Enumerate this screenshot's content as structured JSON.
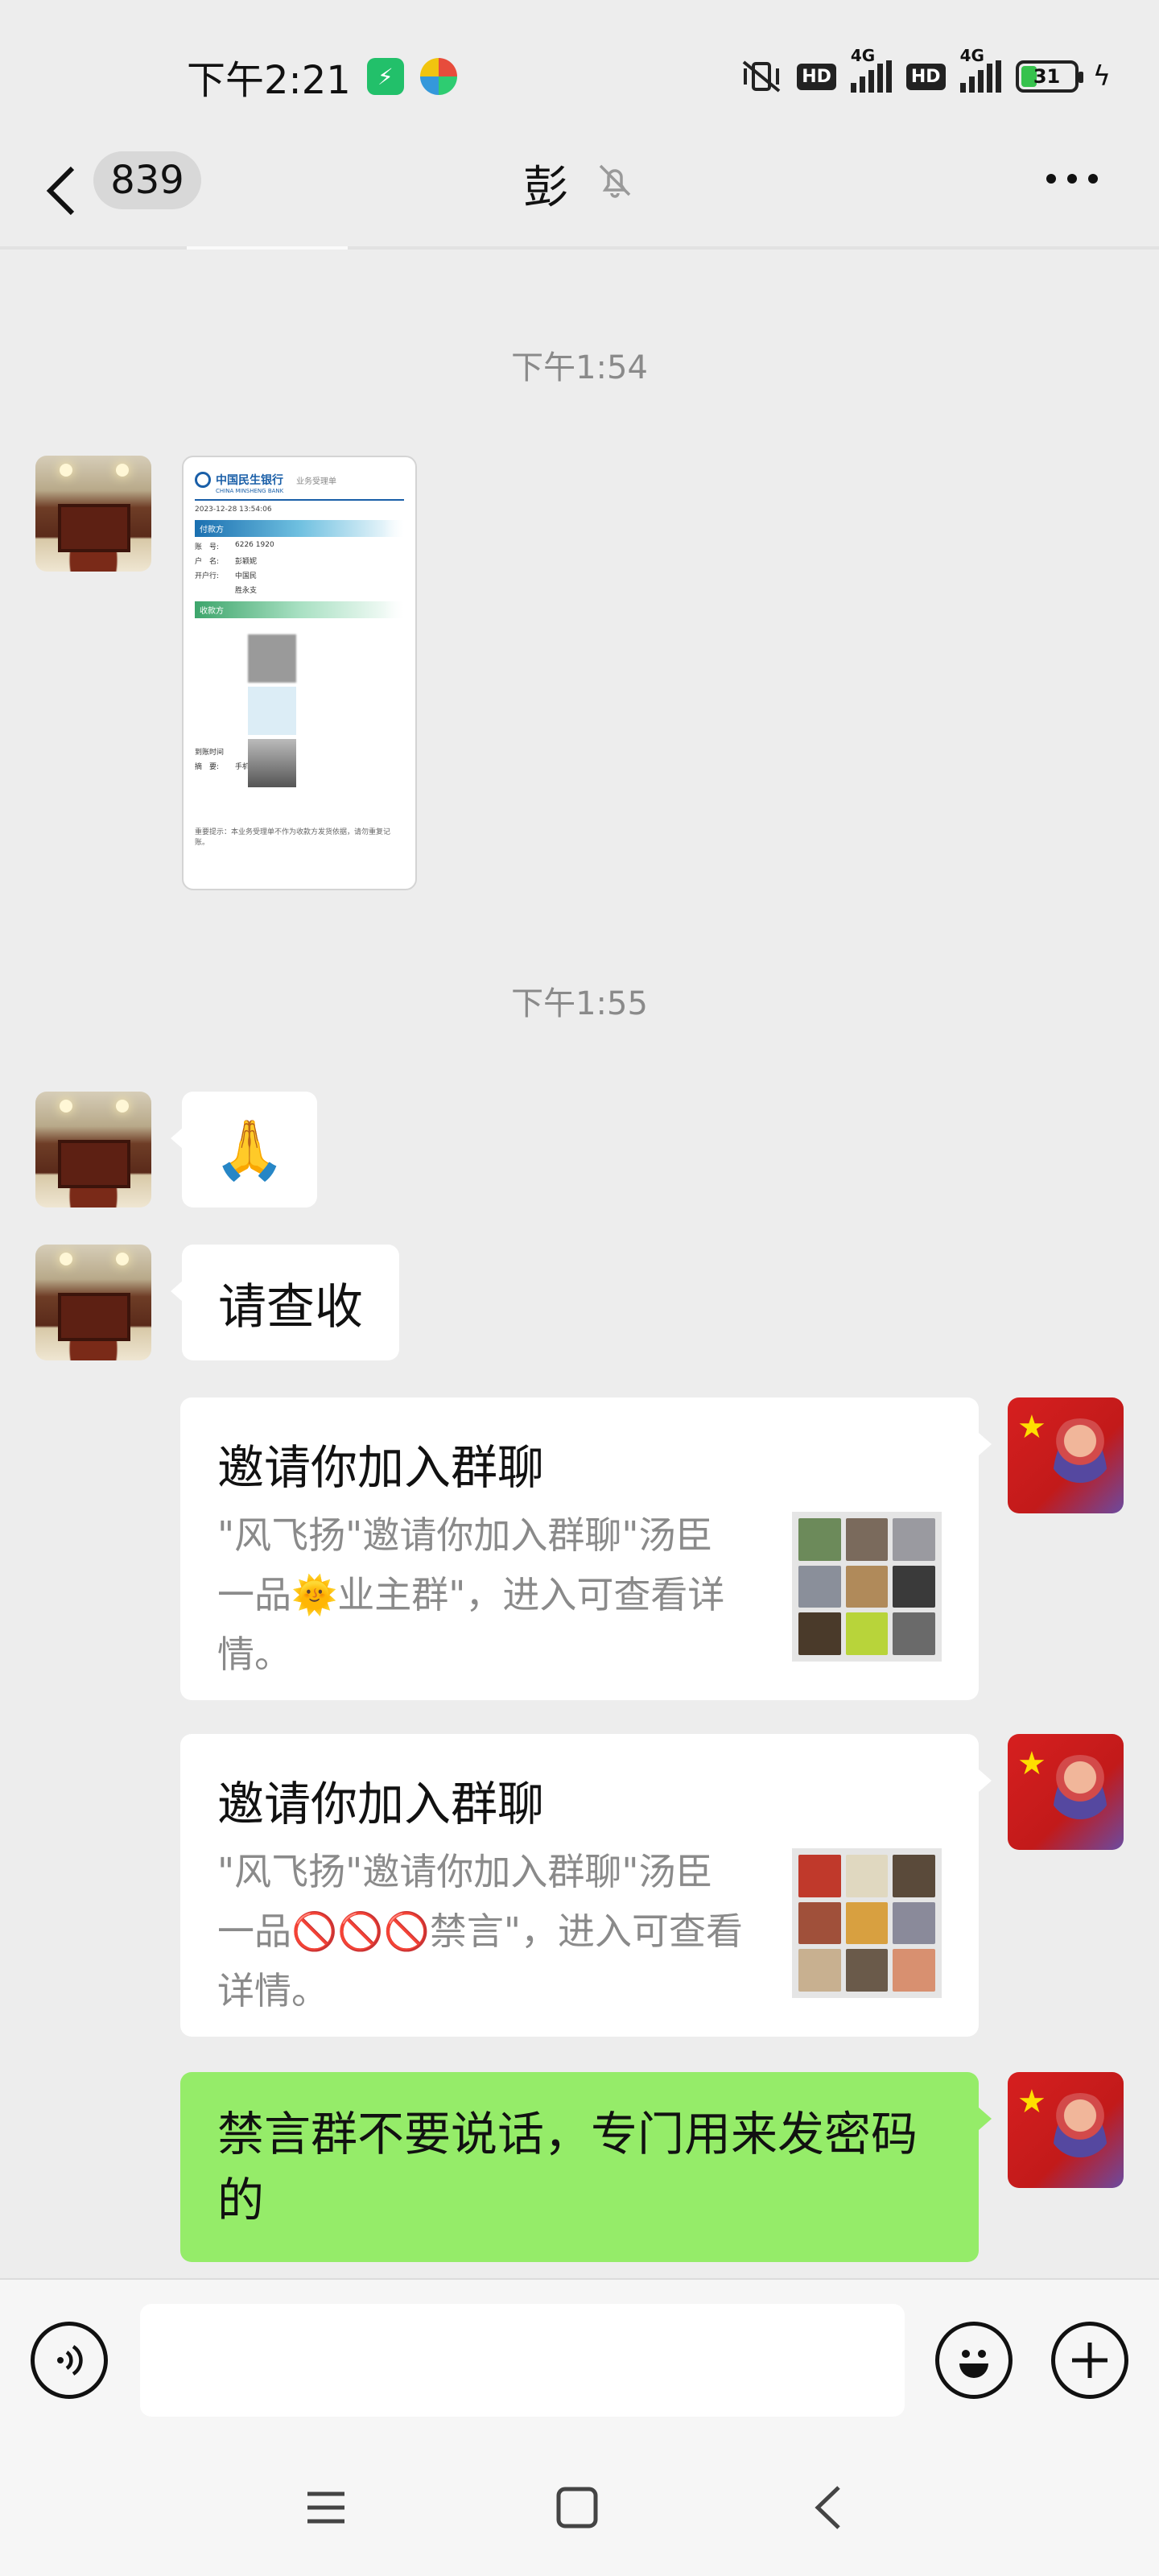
{
  "status_bar": {
    "time": "下午2:21",
    "hd1": "HD",
    "net1": "4G",
    "hd2": "HD",
    "net2": "4G",
    "battery": "31",
    "battery_level": 0.31
  },
  "header": {
    "unread_count": "839",
    "title": "彭"
  },
  "timestamps": [
    "下午1:54",
    "下午1:55"
  ],
  "receipt": {
    "bank_name": "中国民生银行",
    "bank_en": "CHINA MINSHENG BANK",
    "tag": "业务受理单",
    "date": "2023-12-28 13:54:06",
    "payer_band": "付款方",
    "payer_rows": [
      {
        "label": "账　号:",
        "value": "6226 1920"
      },
      {
        "label": "户　名:",
        "value": "彭颖妮"
      },
      {
        "label": "开户行:",
        "value": "中国民"
      }
    ],
    "payer_extra": "胜永支",
    "payee_band": "收款方",
    "rows_bottom": [
      {
        "label": "到账时间",
        "value": ""
      },
      {
        "label": "摘　要:",
        "value": "手机转账"
      }
    ],
    "footer": "重要提示：本业务受理单不作为收款方发货依据，请勿重复记账。"
  },
  "messages": {
    "emoji": "🙏",
    "text1": "请查收",
    "card1": {
      "title": "邀请你加入群聊",
      "desc": "\"风飞扬\"邀请你加入群聊\"汤臣一品🌞业主群\"，进入可查看详情。"
    },
    "card2": {
      "title": "邀请你加入群聊",
      "desc": "\"风飞扬\"邀请你加入群聊\"汤臣一品🚫🚫🚫禁言\"，进入可查看详情。"
    },
    "text2": "禁言群不要说话，专门用来发密码的"
  },
  "input": {
    "placeholder": ""
  },
  "icons": [
    "back-icon",
    "mute-icon",
    "more-icon",
    "voice-icon",
    "emoji-icon",
    "plus-icon",
    "menu-icon",
    "home-icon",
    "nav-back-icon"
  ]
}
